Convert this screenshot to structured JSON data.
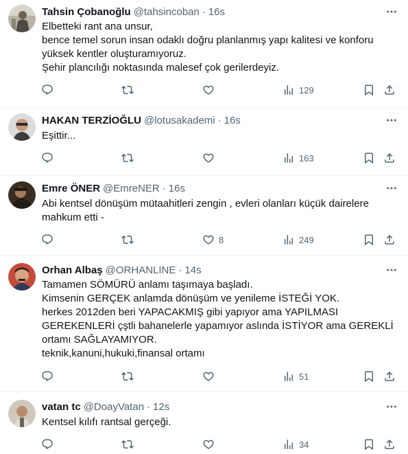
{
  "tweets": [
    {
      "name": "Tahsin Çobanoğlu",
      "handle": "@tahsincoban",
      "time": "16s",
      "lines": [
        "Elbetteki rant ana unsur,",
        "bence temel sorun insan odaklı doğru planlanmış yapı kalitesi ve konforu",
        "yüksek kentler oluşturamıyoruz.",
        "Şehir plancılığı noktasında malesef çok gerilerdeyiz."
      ],
      "likes": "",
      "views": "129"
    },
    {
      "name": "HAKAN TERZİOĞLU",
      "handle": "@lotusakademi",
      "time": "16s",
      "lines": [
        "Eşittir..."
      ],
      "likes": "",
      "views": "163"
    },
    {
      "name": "Emre ÖNER",
      "handle": "@EmreNER",
      "time": "16s",
      "lines": [
        "Abi kentsel dönüşüm mütaahitleri zengin , evleri olanları küçük dairelere",
        "mahkum etti -"
      ],
      "likes": "8",
      "views": "249"
    },
    {
      "name": "Orhan Albaş",
      "handle": "@ORHANLINE",
      "time": "14s",
      "lines": [
        "Tamamen SÖMÜRÜ anlamı taşımaya başladı.",
        "Kimsenin GERÇEK anlamda dönüşüm ve yenileme İSTEĞİ YOK.",
        "herkes 2012den beri YAPACAKMIŞ gibi yapıyor ama YAPILMASI",
        "GEREKENLERİ çştli bahanelerle yapamıyor aslında İSTİYOR ama GEREKLİ",
        "ortamı SAĞLAYAMIYOR.",
        "teknik,kanuni,hukuki,finansal ortamı"
      ],
      "likes": "",
      "views": "51"
    },
    {
      "name": "vatan tc",
      "handle": "@DoayVatan",
      "time": "12s",
      "lines": [
        "Kentsel kılıfı rantsal gerçeği."
      ],
      "likes": "",
      "views": "34"
    }
  ],
  "separator": "·"
}
